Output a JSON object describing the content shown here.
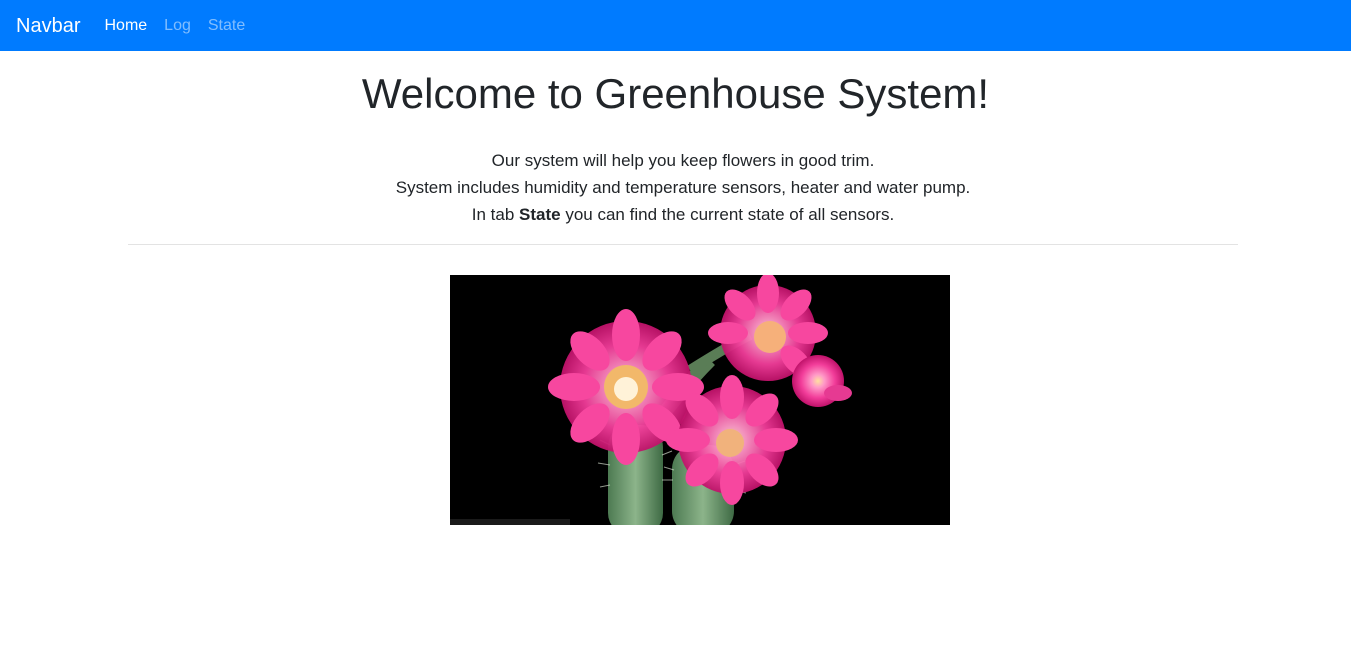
{
  "navbar": {
    "brand": "Navbar",
    "links": [
      {
        "label": "Home",
        "active": true
      },
      {
        "label": "Log",
        "active": false
      },
      {
        "label": "State",
        "active": false
      }
    ],
    "background": "#007bff"
  },
  "main": {
    "title": "Welcome to Greenhouse System!",
    "intro": {
      "line1": "Our system will help you keep flowers in good trim.",
      "line2": "System includes humidity and temperature sensors, heater and water pump.",
      "line3_prefix": "In tab ",
      "line3_bold": "State",
      "line3_suffix": " you can find the current state of all sensors."
    },
    "image": {
      "subject": "flowering cactus with pink blooms on black background",
      "icon": "cactus-flower-image"
    }
  }
}
